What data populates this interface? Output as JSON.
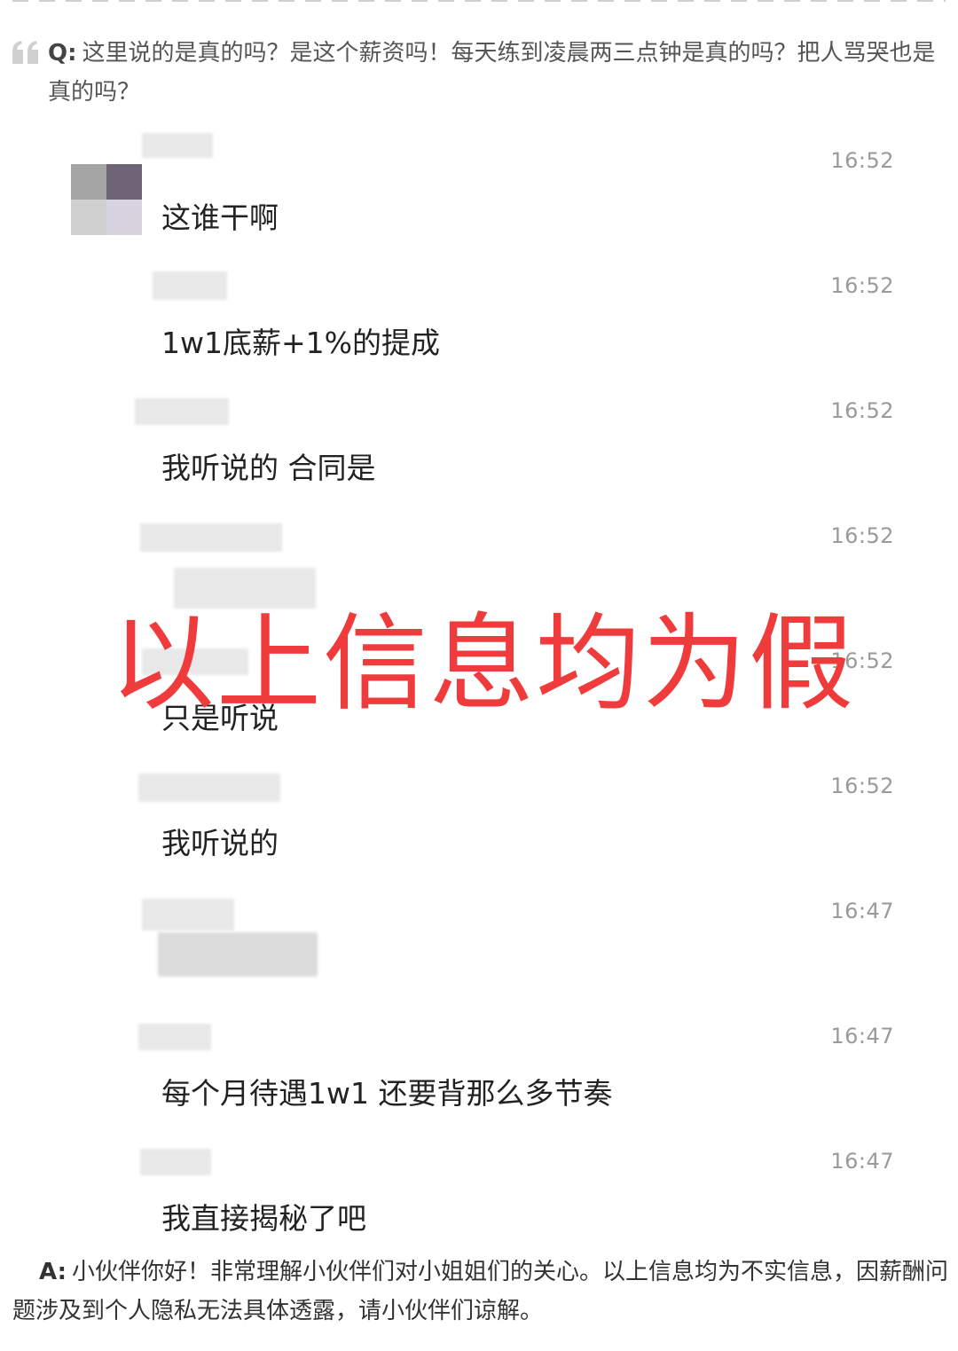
{
  "question": {
    "label": "Q:",
    "text": "这里说的是真的吗？是这个薪资吗！每天练到凌晨两三点钟是真的吗？把人骂哭也是真的吗？"
  },
  "messages": [
    {
      "time": "16:52",
      "text": "这谁干啊"
    },
    {
      "time": "16:52",
      "text": "1w1底薪+1%的提成"
    },
    {
      "time": "16:52",
      "text": "我听说的 合同是"
    },
    {
      "time": "16:52",
      "text": ""
    },
    {
      "time": "16:52",
      "text": "只是听说"
    },
    {
      "time": "16:52",
      "text": "我听说的"
    },
    {
      "time": "16:47",
      "text": ""
    },
    {
      "time": "16:47",
      "text": "每个月待遇1w1 还要背那么多节奏"
    },
    {
      "time": "16:47",
      "text": "我直接揭秘了吧"
    }
  ],
  "watermark": "以上信息均为假",
  "answer": {
    "label": "A:",
    "text": "小伙伴你好！非常理解小伙伴们对小姐姐们的关心。以上信息均为不实信息，因薪酬问题涉及到个人隐私无法具体透露，请小伙伴们谅解。"
  },
  "colors": {
    "watermark": "#ef3b3b",
    "timestamp": "#9a9a9a",
    "message_text": "#222222",
    "censor_blur": "#e4e4e4"
  },
  "icons": {
    "quote": "double-quote-icon",
    "avatar": "pixelated-avatar"
  }
}
